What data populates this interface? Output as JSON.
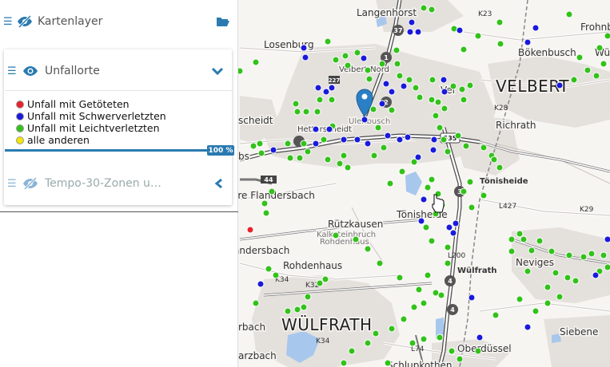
{
  "sidebar": {
    "layers": [
      {
        "title": "Kartenlayer"
      },
      {
        "title": "Unfallorte"
      },
      {
        "title": "Tempo-30-Zonen u…"
      }
    ],
    "legend": [
      {
        "label": "Unfall mit Getöteten",
        "color": "#e8232b"
      },
      {
        "label": "Unfall mit Schwerverletzten",
        "color": "#1a1adb"
      },
      {
        "label": "Unfall mit Leichtverletzten",
        "color": "#33c21a"
      },
      {
        "label": "alle anderen",
        "color": "#f3e600"
      }
    ],
    "progress": {
      "label": "100 %",
      "value": 1.0
    }
  },
  "map": {
    "places": {
      "langenhorst": "Langenhorst",
      "losenburg": "Losenburg",
      "velbert_nord": "Velbert-Nord",
      "velbert": "VELBERT",
      "bokenbusch": "Bökenbusch",
      "frohnb": "Frohnb",
      "richrath": "Richrath",
      "scheidt": "scheidt",
      "hetterscheidt": "Hetterscheidt",
      "ulenbusch": "Ulenbusch",
      "tonisheide_small": "Tönisheide",
      "tonisheide": "Tönisheide",
      "flandersbach": "ere Flandersbach",
      "rutzkausen": "Rützkausen",
      "kalksteinbruch": "Kalksteinbruch",
      "rohdenhaus_small": "Rohdenhaus",
      "rohdenhaus": "Rohdenhaus",
      "andersbach": "andersbach",
      "wulfrath_small": "Wülfrath",
      "wulfrath": "WÜLFRATH",
      "neviges": "Neviges",
      "siebeneich": "Siebene",
      "oberdussel": "Oberdüssel",
      "schlupkothen": "Schlupkothen",
      "rbach": "rbach",
      "arzbach": "arzbach",
      "bs": "bs",
      "vel": "Vel",
      "wu": "Wü"
    },
    "roads": {
      "k23": "K23",
      "k28": "K28",
      "l427": "L427",
      "k29": "K29",
      "k34": "K34",
      "k32": "K32",
      "l200": "L200",
      "l74": "L74",
      "k34b": "K34",
      "r37": "37",
      "r1": "1",
      "r2": "2",
      "r3": "3",
      "r4": "4",
      "r4b": "4",
      "r44": "44",
      "r535": "535",
      "r227": "227"
    }
  },
  "accidents": {
    "fatal": [
      [
        313,
        288
      ]
    ],
    "severe": [
      [
        380,
        60
      ],
      [
        382,
        72
      ],
      [
        455,
        73
      ],
      [
        515,
        28
      ],
      [
        513,
        40
      ],
      [
        523,
        40
      ],
      [
        575,
        38
      ],
      [
        670,
        35
      ],
      [
        398,
        110
      ],
      [
        415,
        110
      ],
      [
        408,
        115
      ],
      [
        483,
        105
      ],
      [
        490,
        115
      ],
      [
        478,
        130
      ],
      [
        505,
        108
      ],
      [
        555,
        100
      ],
      [
        556,
        115
      ],
      [
        395,
        162
      ],
      [
        412,
        162
      ],
      [
        430,
        175
      ],
      [
        447,
        175
      ],
      [
        460,
        180
      ],
      [
        485,
        170
      ],
      [
        500,
        175
      ],
      [
        510,
        172
      ],
      [
        543,
        175
      ],
      [
        542,
        188
      ],
      [
        342,
        188
      ],
      [
        395,
        180
      ],
      [
        523,
        197
      ],
      [
        527,
        277
      ],
      [
        530,
        250
      ],
      [
        562,
        285
      ],
      [
        567,
        292
      ],
      [
        570,
        280
      ],
      [
        456,
        150
      ],
      [
        700,
        107
      ],
      [
        660,
        53
      ],
      [
        590,
        373
      ],
      [
        326,
        356
      ],
      [
        745,
        345
      ],
      [
        660,
        410
      ],
      [
        760,
        300
      ],
      [
        600,
        423
      ]
    ],
    "light": [
      [
        540,
        12
      ],
      [
        530,
        10
      ],
      [
        568,
        36
      ],
      [
        598,
        45
      ],
      [
        410,
        52
      ],
      [
        420,
        75
      ],
      [
        432,
        70
      ],
      [
        435,
        82
      ],
      [
        447,
        66
      ],
      [
        460,
        88
      ],
      [
        462,
        99
      ],
      [
        478,
        80
      ],
      [
        496,
        63
      ],
      [
        497,
        80
      ],
      [
        500,
        95
      ],
      [
        512,
        100
      ],
      [
        520,
        110
      ],
      [
        525,
        122
      ],
      [
        540,
        125
      ],
      [
        548,
        128
      ],
      [
        567,
        108
      ],
      [
        578,
        112
      ],
      [
        588,
        107
      ],
      [
        580,
        125
      ],
      [
        556,
        136
      ],
      [
        545,
        145
      ],
      [
        550,
        160
      ],
      [
        555,
        175
      ],
      [
        560,
        190
      ],
      [
        573,
        170
      ],
      [
        583,
        183
      ],
      [
        605,
        185
      ],
      [
        615,
        195
      ],
      [
        625,
        28
      ],
      [
        626,
        55
      ],
      [
        580,
        62
      ],
      [
        541,
        100
      ],
      [
        490,
        138
      ],
      [
        467,
        137
      ],
      [
        473,
        160
      ],
      [
        480,
        185
      ],
      [
        468,
        195
      ],
      [
        430,
        195
      ],
      [
        416,
        158
      ],
      [
        405,
        175
      ],
      [
        380,
        180
      ],
      [
        385,
        190
      ],
      [
        370,
        130
      ],
      [
        372,
        140
      ],
      [
        383,
        140
      ],
      [
        397,
        140
      ],
      [
        400,
        125
      ],
      [
        415,
        125
      ],
      [
        320,
        78
      ],
      [
        300,
        89
      ],
      [
        317,
        183
      ],
      [
        325,
        180
      ],
      [
        327,
        192
      ],
      [
        360,
        180
      ],
      [
        363,
        198
      ],
      [
        375,
        198
      ],
      [
        410,
        200
      ],
      [
        425,
        205
      ],
      [
        435,
        210
      ],
      [
        518,
        203
      ],
      [
        503,
        215
      ],
      [
        488,
        230
      ],
      [
        540,
        225
      ],
      [
        535,
        235
      ],
      [
        548,
        243
      ],
      [
        553,
        257
      ],
      [
        545,
        268
      ],
      [
        533,
        285
      ],
      [
        540,
        302
      ],
      [
        560,
        310
      ],
      [
        560,
        330
      ],
      [
        535,
        345
      ],
      [
        524,
        363
      ],
      [
        530,
        380
      ],
      [
        518,
        385
      ],
      [
        505,
        400
      ],
      [
        490,
        412
      ],
      [
        470,
        418
      ],
      [
        460,
        430
      ],
      [
        440,
        440
      ],
      [
        430,
        455
      ],
      [
        485,
        455
      ],
      [
        516,
        430
      ],
      [
        530,
        425
      ],
      [
        550,
        423
      ],
      [
        565,
        440
      ],
      [
        575,
        450
      ],
      [
        598,
        440
      ],
      [
        620,
        395
      ],
      [
        650,
        375
      ],
      [
        670,
        390
      ],
      [
        685,
        380
      ],
      [
        700,
        372
      ],
      [
        710,
        348
      ],
      [
        730,
        322
      ],
      [
        740,
        318
      ],
      [
        712,
        320
      ],
      [
        690,
        315
      ],
      [
        675,
        302
      ],
      [
        655,
        300
      ],
      [
        650,
        293
      ],
      [
        660,
        340
      ],
      [
        685,
        360
      ],
      [
        695,
        342
      ],
      [
        720,
        352
      ],
      [
        750,
        340
      ],
      [
        760,
        335
      ],
      [
        755,
        320
      ],
      [
        640,
        300
      ],
      [
        545,
        367
      ],
      [
        552,
        370
      ],
      [
        500,
        348
      ],
      [
        475,
        330
      ],
      [
        460,
        312
      ],
      [
        445,
        300
      ],
      [
        420,
        295
      ],
      [
        407,
        350
      ],
      [
        400,
        355
      ],
      [
        385,
        372
      ],
      [
        380,
        385
      ],
      [
        372,
        388
      ],
      [
        360,
        390
      ],
      [
        345,
        345
      ],
      [
        336,
        337
      ],
      [
        320,
        380
      ],
      [
        331,
        255
      ],
      [
        333,
        267
      ],
      [
        340,
        240
      ],
      [
        746,
        95
      ],
      [
        755,
        80
      ],
      [
        750,
        60
      ],
      [
        760,
        45
      ],
      [
        718,
        100
      ],
      [
        712,
        18
      ],
      [
        735,
        88
      ],
      [
        725,
        72
      ],
      [
        640,
        315
      ],
      [
        665,
        314
      ],
      [
        618,
        200
      ],
      [
        625,
        210
      ],
      [
        605,
        245
      ],
      [
        590,
        260
      ],
      [
        580,
        240
      ],
      [
        588,
        228
      ]
    ]
  }
}
